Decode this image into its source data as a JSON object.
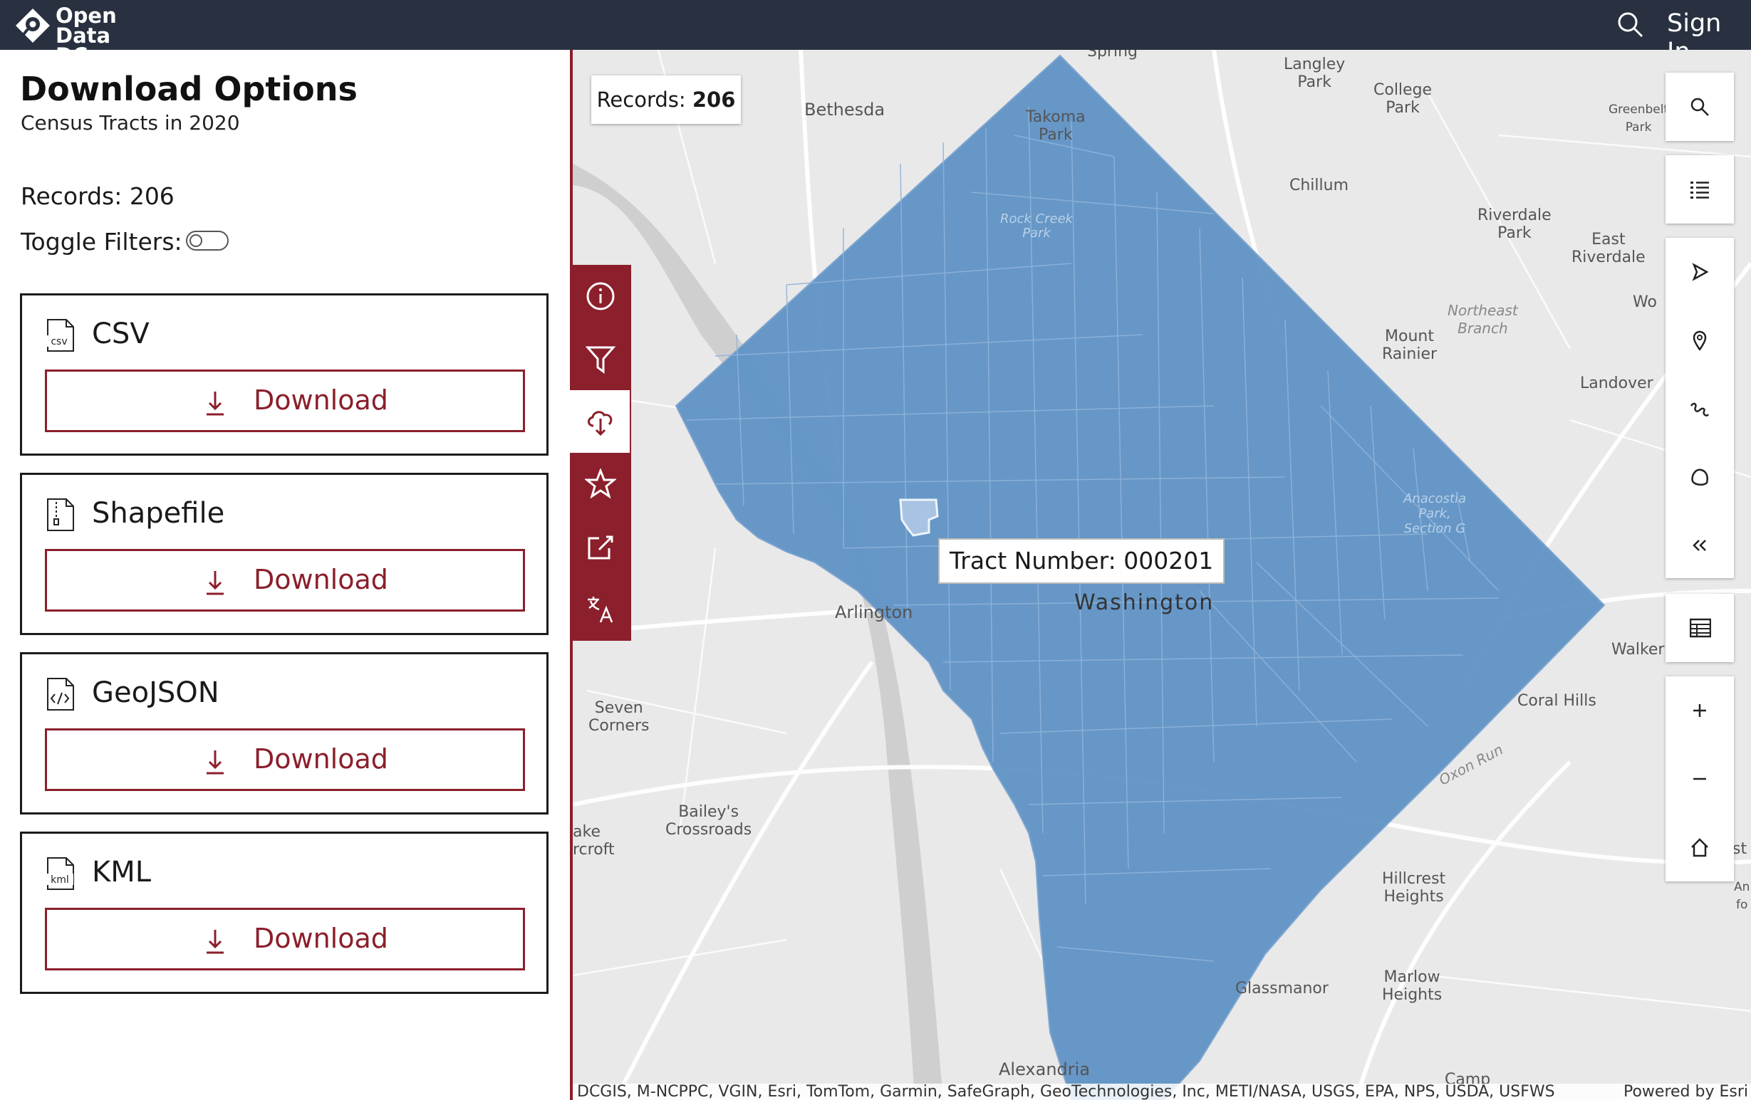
{
  "header": {
    "logo_line1": "Open",
    "logo_line2": "Data DC",
    "signin_label": "Sign In"
  },
  "panel": {
    "title": "Download Options",
    "subtitle": "Census Tracts in 2020",
    "records_text": "Records: 206",
    "toggle_label": "Toggle Filters:",
    "toggle_on": false,
    "formats": [
      {
        "name": "CSV",
        "icon": "csv-file-icon",
        "button": "Download"
      },
      {
        "name": "Shapefile",
        "icon": "zip-file-icon",
        "button": "Download"
      },
      {
        "name": "GeoJSON",
        "icon": "code-file-icon",
        "button": "Download"
      },
      {
        "name": "KML",
        "icon": "kml-file-icon",
        "button": "Download"
      }
    ]
  },
  "map": {
    "records_label": "Records:",
    "records_value": "206",
    "tooltip": "Tract Number: 000201",
    "labels": {
      "spring": "Spring",
      "bethesda": "Bethesda",
      "langley": "Langley\nPark",
      "takoma": "Takoma\nPark",
      "college": "College\nPark",
      "greenbelt": "Greenbelt\nPark",
      "chillum": "Chillum",
      "riverdale": "Riverdale\nPark",
      "east_riverdale": "East\nRiverdale",
      "rock_creek": "Rock Creek\nPark",
      "northeast": "Northeast\nBranch",
      "mount_rainier": "Mount\nRainier",
      "landover": "Landover",
      "anacostia": "Anacostia\nPark,\nSection G",
      "arlington": "Arlington",
      "washington": "Washington",
      "walker": "Walker",
      "seven": "Seven\nCorners",
      "coral": "Coral Hills",
      "oxon": "Oxon Run",
      "baileys": "Bailey's\nCrossroads",
      "hillcrest": "Hillcrest\nHeights",
      "marlow": "Marlow\nHeights",
      "glassmanor": "Glassmanor",
      "alexandria": "Alexandria",
      "camp": "Camp",
      "lake": "ake\nrcroft",
      "wo": "Wo",
      "st": "st",
      "an": "An\nfo"
    },
    "attribution": "DCGIS, M-NCPPC, VGIN, Esri, TomTom, Garmin, SafeGraph, GeoTechnologies, Inc, METI/NASA, USGS, EPA, NPS, USDA, USFWS",
    "powered_by": "Powered by Esri"
  },
  "colors": {
    "header_bg": "#293140",
    "accent": "#8b1f2b",
    "tract_fill": "#5f93c6",
    "map_bg": "#e9e9e9"
  }
}
